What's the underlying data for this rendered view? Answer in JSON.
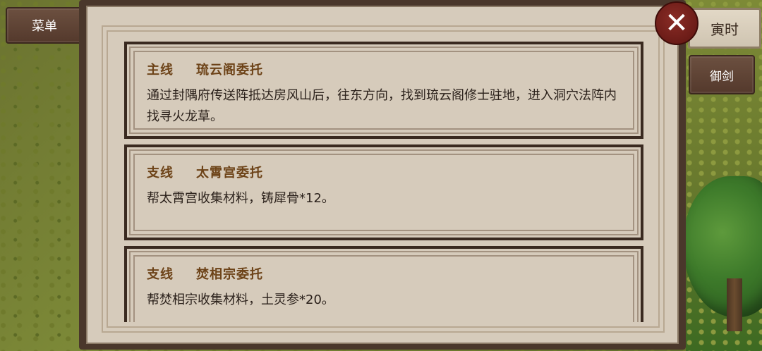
{
  "hud": {
    "menu_label": "菜单",
    "time_label": "寅时",
    "sword_label": "御剑"
  },
  "close_icon": "close-x-icon",
  "quests": [
    {
      "type": "主线",
      "title": "琉云阁委托",
      "desc": "通过封隅府传送阵抵达房风山后，往东方向，找到琉云阁修士驻地，进入洞穴法阵内找寻火龙草。"
    },
    {
      "type": "支线",
      "title": "太霄宫委托",
      "desc": "帮太霄宫收集材料，铸犀骨*12。"
    },
    {
      "type": "支线",
      "title": "焚相宗委托",
      "desc": "帮焚相宗收集材料，土灵参*20。"
    }
  ]
}
